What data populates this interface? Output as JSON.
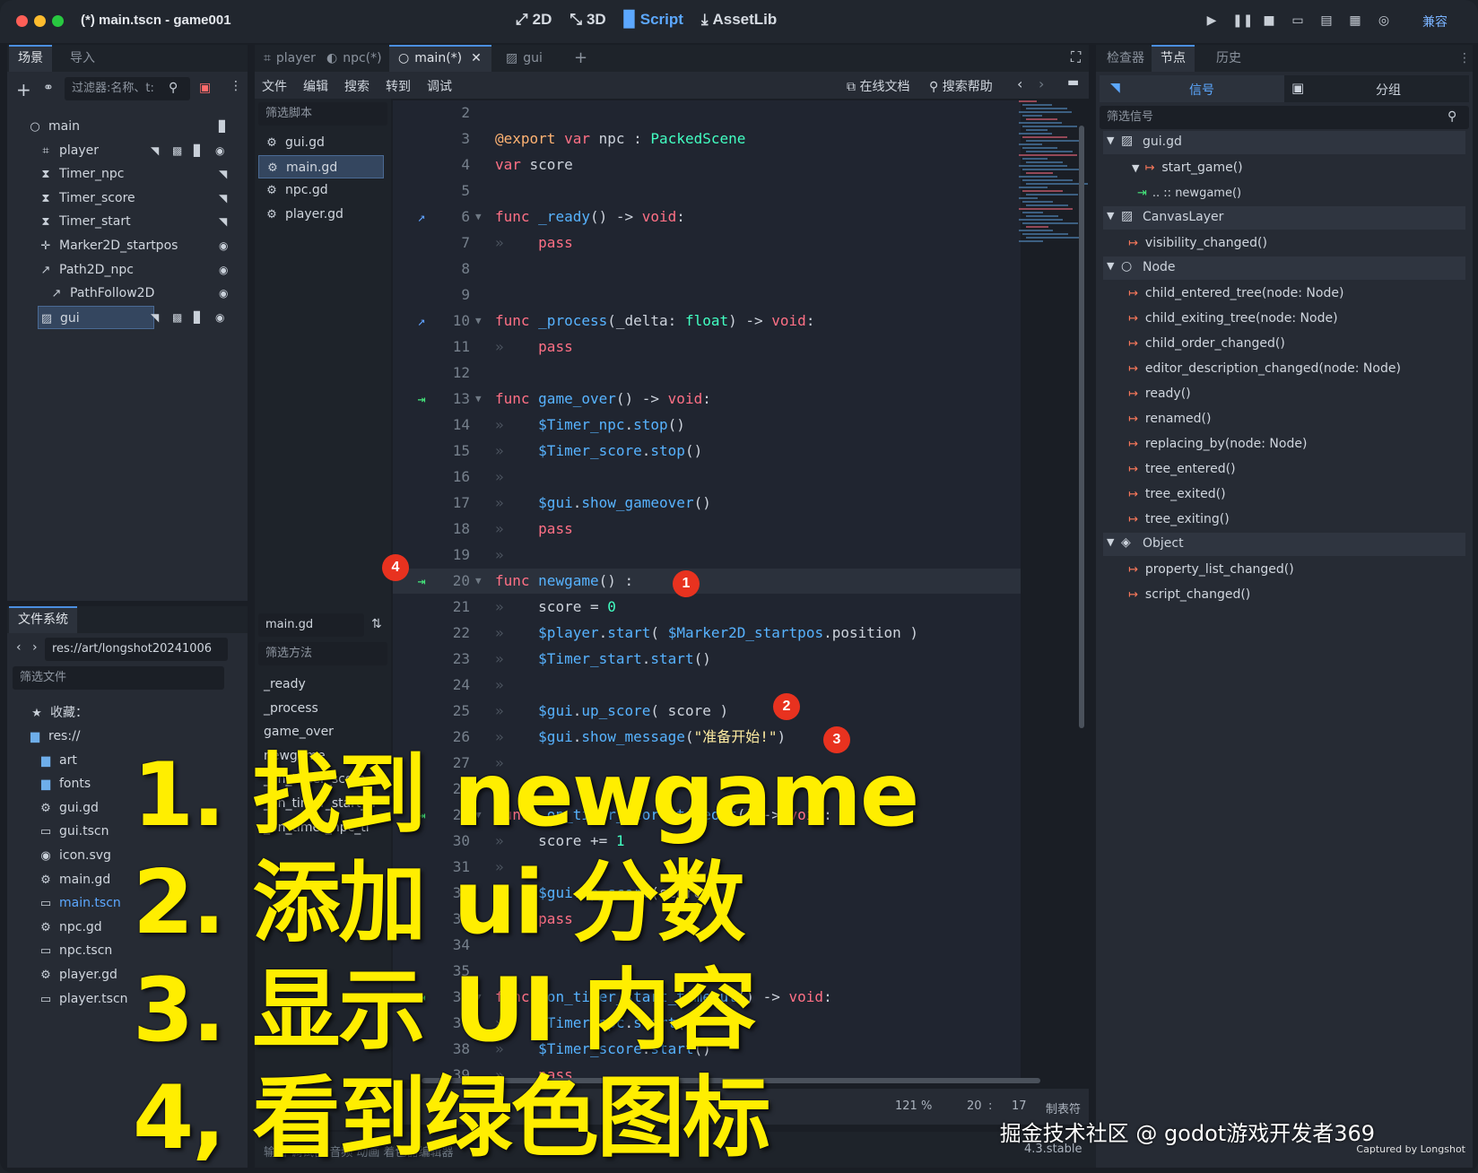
{
  "window": {
    "title": "(*) main.tscn - game001"
  },
  "modes": [
    {
      "label": "2D",
      "icon": "2d-icon"
    },
    {
      "label": "3D",
      "icon": "3d-icon"
    },
    {
      "label": "Script",
      "icon": "script-icon"
    },
    {
      "label": "AssetLib",
      "icon": "assetlib-icon"
    }
  ],
  "compat_label": "兼容",
  "scene_panel": {
    "tabs": [
      "场景",
      "导入"
    ],
    "filter_placeholder": "过滤器:名称、t:",
    "nodes": [
      {
        "label": "main",
        "icon": "node-icon"
      },
      {
        "label": "player",
        "icon": "area2d-icon"
      },
      {
        "label": "Timer_npc",
        "icon": "timer-icon"
      },
      {
        "label": "Timer_score",
        "icon": "timer-icon"
      },
      {
        "label": "Timer_start",
        "icon": "timer-icon"
      },
      {
        "label": "Marker2D_startpos",
        "icon": "marker-icon"
      },
      {
        "label": "Path2D_npc",
        "icon": "path-icon"
      },
      {
        "label": "PathFollow2D",
        "icon": "path-icon"
      },
      {
        "label": "gui",
        "icon": "canvaslayer-icon"
      }
    ]
  },
  "filesystem": {
    "tab": "文件系统",
    "path": "res://art/longshot20241006",
    "filter_placeholder": "筛选文件",
    "favorites": "收藏：",
    "items": [
      {
        "label": "res://",
        "type": "folder"
      },
      {
        "label": "art",
        "type": "folder"
      },
      {
        "label": "fonts",
        "type": "folder"
      },
      {
        "label": "gui.gd",
        "type": "script"
      },
      {
        "label": "gui.tscn",
        "type": "scene"
      },
      {
        "label": "icon.svg",
        "type": "image"
      },
      {
        "label": "main.gd",
        "type": "script"
      },
      {
        "label": "main.tscn",
        "type": "scene"
      },
      {
        "label": "npc.gd",
        "type": "script"
      },
      {
        "label": "npc.tscn",
        "type": "scene"
      },
      {
        "label": "player.gd",
        "type": "script"
      },
      {
        "label": "player.tscn",
        "type": "scene"
      }
    ]
  },
  "editor_tabs": [
    "player",
    "npc(*)",
    "main(*)",
    "gui"
  ],
  "script_menu": [
    "文件",
    "编辑",
    "搜索",
    "转到",
    "调试"
  ],
  "online_docs": "在线文档",
  "search_help": "搜索帮助",
  "script_list": {
    "filter_placeholder": "筛选脚本",
    "items": [
      "gui.gd",
      "main.gd",
      "npc.gd",
      "player.gd"
    ],
    "current": "main.gd",
    "method_filter_placeholder": "筛选方法",
    "methods": [
      "_ready",
      "_process",
      "game_over",
      "newgame",
      "_on_timer_score",
      "_on_timer_start_ti",
      "_on_timer_npc_ti"
    ]
  },
  "code_lines": [
    {
      "n": "2",
      "html": ""
    },
    {
      "n": "3",
      "html": "<span class=\"ex\">@export</span> <span class=\"kw\">var</span> npc : <span class=\"ty\">PackedScene</span>"
    },
    {
      "n": "4",
      "html": "<span class=\"kw\">var</span> score"
    },
    {
      "n": "5",
      "html": ""
    },
    {
      "n": "6",
      "gut": "override-icon",
      "fold": true,
      "html": "<span class=\"kw\">func</span> <span class=\"fn\">_ready</span>() -> <span class=\"kw\">void</span>:"
    },
    {
      "n": "7",
      "html": "<span class=\"cm\">»</span>    <span class=\"kw\">pass</span>"
    },
    {
      "n": "8",
      "html": ""
    },
    {
      "n": "9",
      "html": ""
    },
    {
      "n": "10",
      "gut": "override-icon",
      "fold": true,
      "html": "<span class=\"kw\">func</span> <span class=\"fn\">_process</span>(_delta: <span class=\"ty\">float</span>) -> <span class=\"kw\">void</span>:"
    },
    {
      "n": "11",
      "html": "<span class=\"cm\">»</span>    <span class=\"kw\">pass</span>"
    },
    {
      "n": "12",
      "html": ""
    },
    {
      "n": "13",
      "gut": "signal-connected-icon",
      "fold": true,
      "html": "<span class=\"kw\">func</span> <span class=\"fn\">game_over</span>() -> <span class=\"kw\">void</span>:"
    },
    {
      "n": "14",
      "html": "<span class=\"cm\">»</span>    <span class=\"fn\">$Timer_npc</span>.<span class=\"fn\">stop</span>()"
    },
    {
      "n": "15",
      "html": "<span class=\"cm\">»</span>    <span class=\"fn\">$Timer_score</span>.<span class=\"fn\">stop</span>()"
    },
    {
      "n": "16",
      "html": "<span class=\"cm\">»</span>"
    },
    {
      "n": "17",
      "html": "<span class=\"cm\">»</span>    <span class=\"fn\">$gui</span>.<span class=\"fn\">show_gameover</span>()"
    },
    {
      "n": "18",
      "html": "<span class=\"cm\">»</span>    <span class=\"kw\">pass</span>"
    },
    {
      "n": "19",
      "html": "<span class=\"cm\">»</span>"
    },
    {
      "n": "20",
      "gut": "signal-connected-icon",
      "fold": true,
      "cur": true,
      "html": "<span class=\"kw\">func</span> <span class=\"fn\">newgame</span>() :"
    },
    {
      "n": "21",
      "html": "<span class=\"cm\">»</span>    score = <span class=\"ty\">0</span>"
    },
    {
      "n": "22",
      "html": "<span class=\"cm\">»</span>    <span class=\"fn\">$player</span>.<span class=\"fn\">start</span>( <span class=\"fn\">$Marker2D_startpos</span>.position )"
    },
    {
      "n": "23",
      "html": "<span class=\"cm\">»</span>    <span class=\"fn\">$Timer_start</span>.<span class=\"fn\">start</span>()"
    },
    {
      "n": "24",
      "html": "<span class=\"cm\">»</span>"
    },
    {
      "n": "25",
      "html": "<span class=\"cm\">»</span>    <span class=\"fn\">$gui</span>.<span class=\"fn\">up_score</span>( score )"
    },
    {
      "n": "26",
      "html": "<span class=\"cm\">»</span>    <span class=\"fn\">$gui</span>.<span class=\"fn\">show_message</span>(<span class=\"str\">\"准备开始!\"</span>)"
    },
    {
      "n": "27",
      "html": "<span class=\"cm\">»</span>"
    },
    {
      "n": "28",
      "html": ""
    },
    {
      "n": "29",
      "gut": "signal-connected-icon",
      "fold": true,
      "html": "<span class=\"kw\">func</span> <span class=\"fn\">_on_timer_score_timeout</span>() -> <span class=\"kw\">void</span>:"
    },
    {
      "n": "30",
      "html": "<span class=\"cm\">»</span>    score += <span class=\"ty\">1</span>"
    },
    {
      "n": "31",
      "html": "<span class=\"cm\">»</span>"
    },
    {
      "n": "32",
      "html": "<span class=\"cm\">»</span>    <span class=\"fn\">$gui</span>.<span class=\"fn\">up_score</span>(score)"
    },
    {
      "n": "33",
      "html": "<span class=\"cm\">»</span>    <span class=\"kw\">pass</span>"
    },
    {
      "n": "34",
      "html": ""
    },
    {
      "n": "35",
      "html": ""
    },
    {
      "n": "36",
      "gut": "signal-connected-icon",
      "fold": true,
      "html": "<span class=\"kw\">func</span> <span class=\"fn\">_on_timer_start_timeout</span>() -> <span class=\"kw\">void</span>:"
    },
    {
      "n": "37",
      "html": "<span class=\"cm\">»</span>    <span class=\"fn\">$Timer_npc</span>.<span class=\"fn\">start</span>()"
    },
    {
      "n": "38",
      "html": "<span class=\"cm\">»</span>    <span class=\"fn\">$Timer_score</span>.<span class=\"fn\">start</span>()"
    },
    {
      "n": "39",
      "html": "<span class=\"cm\">»</span>    <span class=\"kw\">pass</span>"
    }
  ],
  "status": {
    "zoom": "121 %",
    "line": "20",
    "col": "17",
    "indent": "制表符",
    "version": "4.3.stable",
    "bottom_tabs": "输出  调试器  音频  动画  着色器编辑器"
  },
  "right_panel": {
    "tabs": [
      "检查器",
      "节点",
      "历史"
    ],
    "subtabs": [
      "信号",
      "分组"
    ],
    "filter_placeholder": "筛选信号",
    "groups": [
      {
        "label": "gui.gd",
        "icon": "script-icon",
        "signals": [
          "start_game()"
        ],
        "connections": [
          ".. :: newgame()"
        ]
      },
      {
        "label": "CanvasLayer",
        "icon": "canvaslayer-icon",
        "signals": [
          "visibility_changed()"
        ]
      },
      {
        "label": "Node",
        "icon": "node-icon",
        "signals": [
          "child_entered_tree(node: Node)",
          "child_exiting_tree(node: Node)",
          "child_order_changed()",
          "editor_description_changed(node: Node)",
          "ready()",
          "renamed()",
          "replacing_by(node: Node)",
          "tree_entered()",
          "tree_exited()",
          "tree_exiting()"
        ]
      },
      {
        "label": "Object",
        "icon": "object-icon",
        "signals": [
          "property_list_changed()",
          "script_changed()"
        ]
      }
    ]
  },
  "annotations": {
    "markers": [
      "1",
      "2",
      "3",
      "4"
    ],
    "steps": [
      "1. 找到 newgame",
      "2. 添加 ui 分数",
      "3. 显示 UI 内容",
      "4, 看到绿色图标"
    ]
  },
  "watermark": "掘金技术社区 @ godot游戏开发者369",
  "captured": "Captured by Longshot",
  "accent": "#5ca8ff",
  "marker_color": "#e8321f",
  "overlay_color": "#ffee00"
}
